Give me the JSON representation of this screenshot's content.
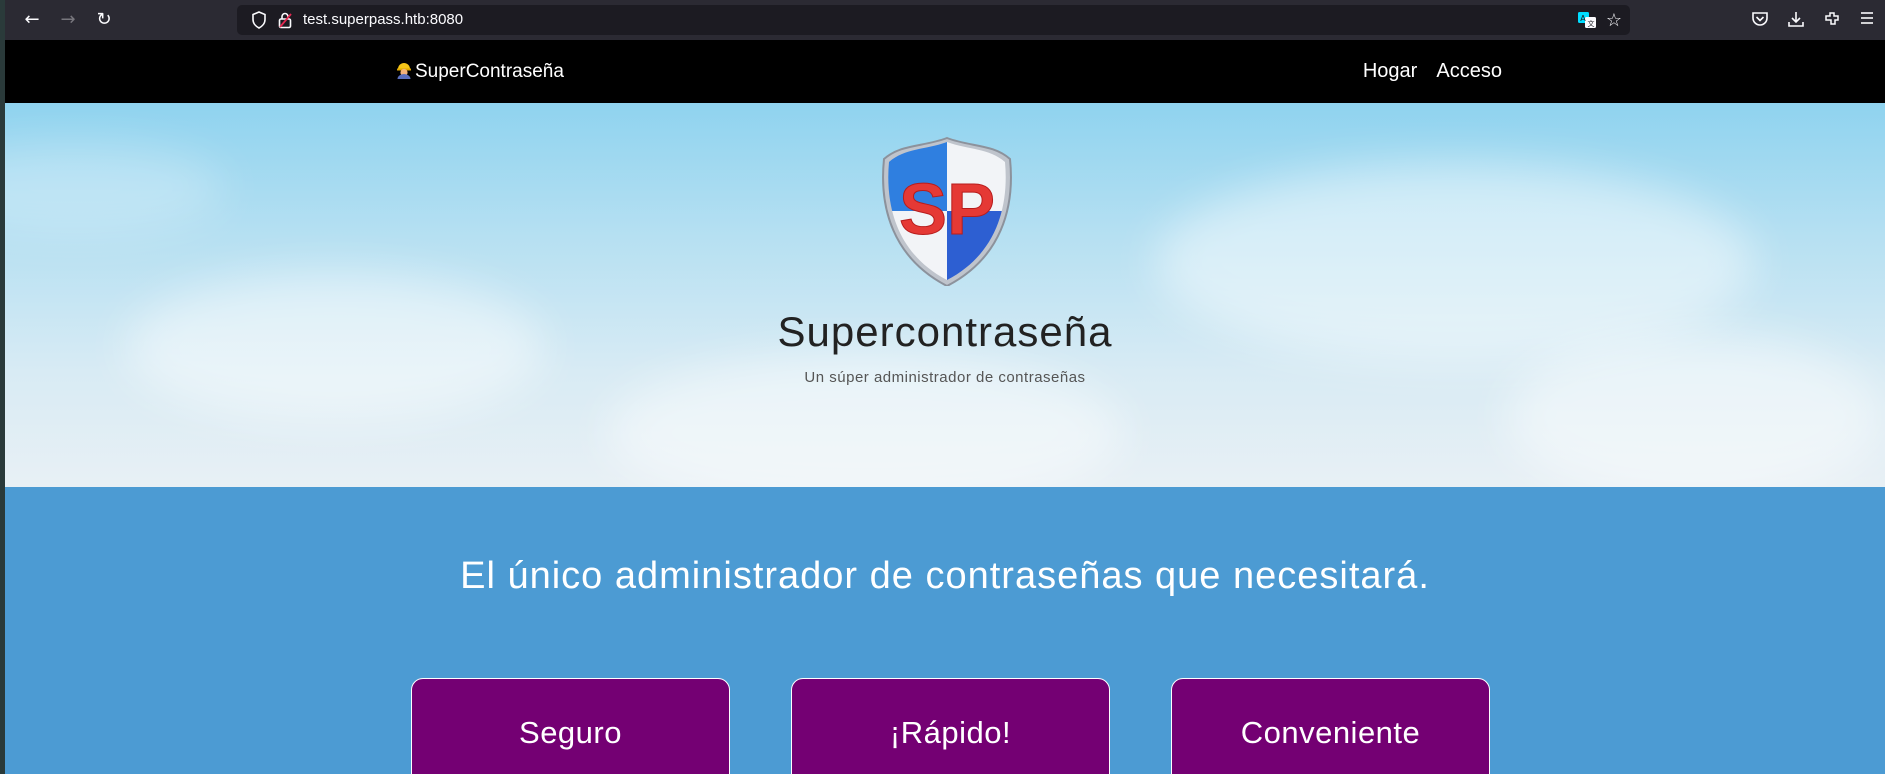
{
  "browser": {
    "url": "test.superpass.htb:8080",
    "icons": [
      "back-icon",
      "forward-icon",
      "reload-icon",
      "shield-icon",
      "lock-icon",
      "translate-icon",
      "star-icon",
      "pocket-icon",
      "download-icon",
      "extensions-icon",
      "menu-icon"
    ]
  },
  "nav": {
    "brand": "SuperContraseña",
    "links": [
      "Hogar",
      "Acceso"
    ]
  },
  "hero": {
    "logo_text": "SP",
    "title": "Supercontraseña",
    "subtitle": "Un súper administrador de contraseñas"
  },
  "features": {
    "heading": "El único administrador de contraseñas que necesitará.",
    "cards": [
      {
        "title": "Seguro"
      },
      {
        "title": "¡Rápido!"
      },
      {
        "title": "Conveniente"
      }
    ]
  },
  "colors": {
    "nav_bg": "#000000",
    "features_bg": "#4c9bd3",
    "card_bg": "#740073",
    "logo_red": "#e53935",
    "logo_blue": "#2d6fd6"
  }
}
